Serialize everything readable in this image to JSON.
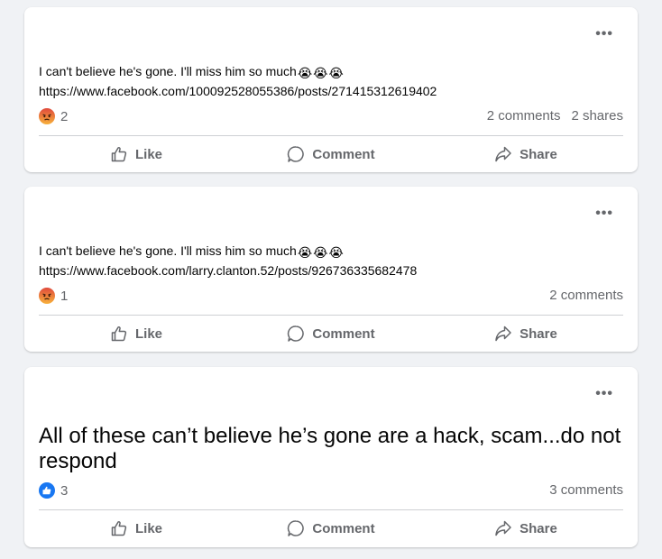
{
  "posts": [
    {
      "text": "I can't believe he's gone. I'll miss him so much",
      "emojis": [
        "😭",
        "😭",
        "😭"
      ],
      "link": "https://www.facebook.com/100092528055386/posts/271415312619402",
      "reaction": {
        "icon": "angry-reaction-icon",
        "count": "2"
      },
      "comments": "2 comments",
      "shares": "2 shares",
      "actions": {
        "like": "Like",
        "comment": "Comment",
        "share": "Share"
      }
    },
    {
      "text": "I can't believe he's gone. I'll miss him so much",
      "emojis": [
        "😭",
        "😭",
        "😭"
      ],
      "link": "https://www.facebook.com/larry.clanton.52/posts/926736335682478",
      "reaction": {
        "icon": "angry-reaction-icon",
        "count": "1"
      },
      "comments": "2 comments",
      "actions": {
        "like": "Like",
        "comment": "Comment",
        "share": "Share"
      }
    },
    {
      "text": "All of these can’t believe he’s gone are a hack, scam...do not respond",
      "reaction": {
        "icon": "like-reaction-icon",
        "count": "3"
      },
      "comments": "3 comments",
      "actions": {
        "like": "Like",
        "comment": "Comment",
        "share": "Share"
      }
    }
  ],
  "more_label": "•••",
  "colors": {
    "background": "#f0f2f5",
    "angry": "#f07c3c",
    "like": "#1877f2",
    "muted": "#65676b"
  }
}
